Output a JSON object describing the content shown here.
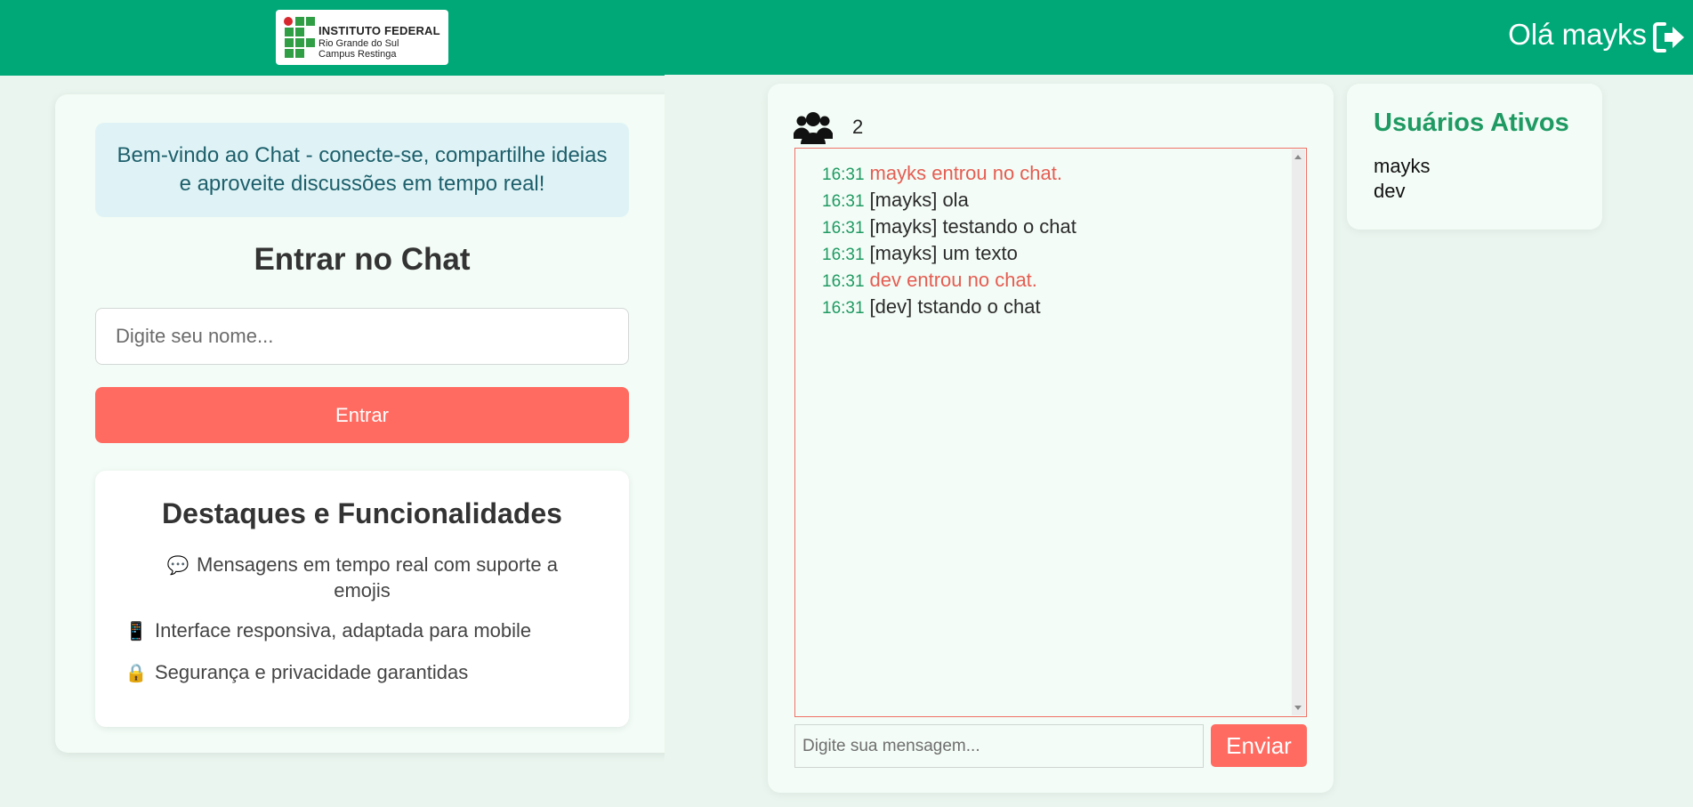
{
  "logo": {
    "line1": "INSTITUTO FEDERAL",
    "line2": "Rio Grande do Sul",
    "line3": "Campus Restinga",
    "icon": "if-logo"
  },
  "login": {
    "welcome": "Bem-vindo ao Chat - conecte-se, compartilhe ideias e aproveite discussões em tempo real!",
    "title": "Entrar no Chat",
    "name_placeholder": "Digite seu nome...",
    "enter_label": "Entrar"
  },
  "features": {
    "title": "Destaques e Funcionalidades",
    "items": [
      {
        "icon": "💬",
        "icon_name": "speech-bubble-icon",
        "text": "Mensagens em tempo real com suporte a emojis"
      },
      {
        "icon": "📱",
        "icon_name": "mobile-phone-icon",
        "text": "Interface responsiva, adaptada para mobile"
      },
      {
        "icon": "🔒",
        "icon_name": "lock-icon",
        "text": "Segurança e privacidade garantidas"
      }
    ]
  },
  "header": {
    "greeting": "Olá mayks",
    "logout_icon": "logout-icon"
  },
  "chat": {
    "user_count": "2",
    "users_icon": "users-icon",
    "messages": [
      {
        "time": "16:31",
        "text": "mayks entrou no chat.",
        "kind": "system"
      },
      {
        "time": "16:31",
        "text": "[mayks] ola",
        "kind": "chat"
      },
      {
        "time": "16:31",
        "text": "[mayks] testando o chat",
        "kind": "chat"
      },
      {
        "time": "16:31",
        "text": "[mayks] um texto",
        "kind": "chat"
      },
      {
        "time": "16:31",
        "text": "dev entrou no chat.",
        "kind": "system"
      },
      {
        "time": "16:31",
        "text": "[dev] tstando o chat",
        "kind": "chat"
      }
    ],
    "input_placeholder": "Digite sua mensagem...",
    "send_label": "Enviar"
  },
  "active_users": {
    "title": "Usuários Ativos",
    "users": [
      "mayks",
      "dev"
    ]
  },
  "colors": {
    "header_green": "#00a878",
    "accent_coral": "#ff6b61",
    "system_message": "#e55d52",
    "timestamp_green": "#1f9a63"
  }
}
